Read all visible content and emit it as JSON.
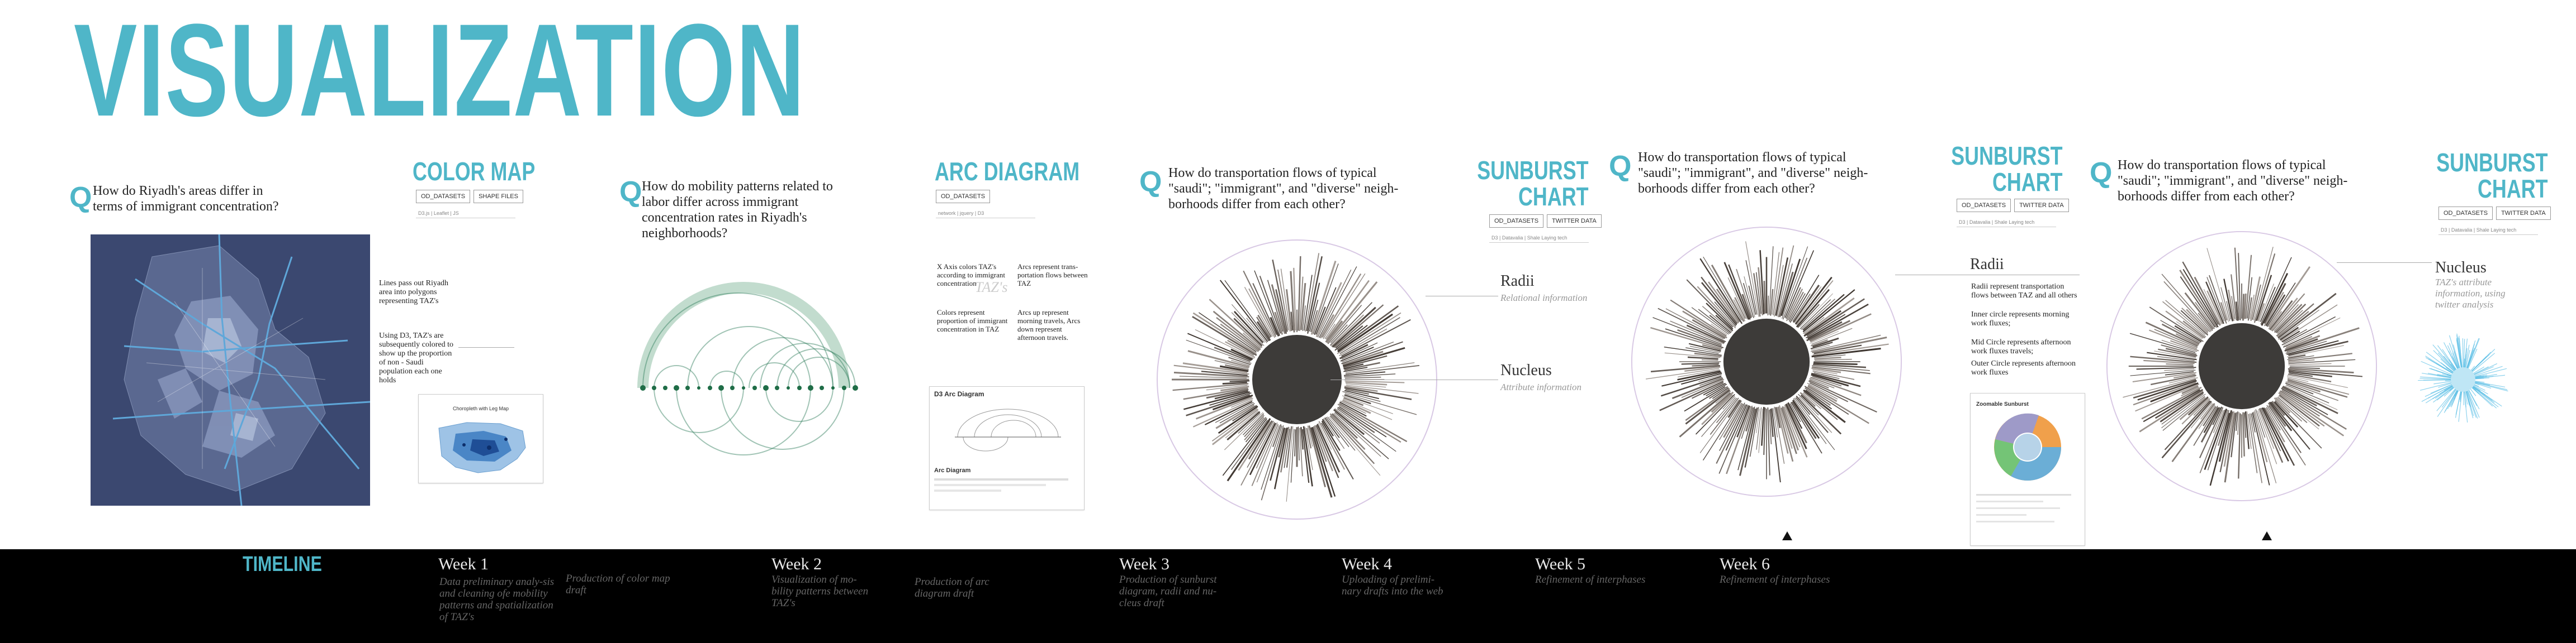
{
  "title": "VISUALIZATION",
  "panel1": {
    "q": "Q",
    "question": "How do Riyadh's areas differ in terms of immigrant concentration?",
    "title": "COLOR MAP",
    "chips": [
      "OD_DATASETS",
      "SHAPE FILES"
    ],
    "meta": "D3.js  |  Leaflet  |  JS",
    "note1": "Lines pass out Riyadh area into polygons representing TAZ's",
    "note2": "Using D3, TAZ's are subsequently colored to show up the proportion of non - Saudi population each one holds",
    "thumb_title": "Choropleth with Leg Map"
  },
  "panel2": {
    "q": "Q",
    "question": "How do mobility patterns related to labor differ across immigrant concentration rates in Riyadh's neighborhoods?",
    "title": "ARC DIAGRAM",
    "chips": [
      "OD_DATASETS"
    ],
    "meta": "network  |  jquery  |  D3",
    "note_x": "X Axis colors TAZ's according to immigrant concentration",
    "note_colors": "Colors represent proportion of immigrant concentration in TAZ",
    "note_arcs_rep": "Arcs represent trans-portation flows between TAZ",
    "note_arcs_up": "Arcs up represent morning travels, Arcs down represent afternoon travels.",
    "ghost": "TAZ's",
    "thumb_title": "D3 Arc Diagram",
    "thumb_sub": "Arc Diagram"
  },
  "panel3": {
    "q": "Q",
    "question": "How do transportation flows of typical \"saudi\"; \"immigrant\", and \"diverse\" neigh-borhoods differ from each other?",
    "title1": "SUNBURST",
    "title2": "CHART",
    "chips": [
      "OD_DATASETS",
      "TWITTER DATA"
    ],
    "meta": "D3  |  Datavalia  |  Shale  Laying tech",
    "radii": "Radii",
    "radii_sub": "Relational information",
    "nucleus": "Nucleus",
    "nucleus_sub": "Attribute information"
  },
  "panel4": {
    "q": "Q",
    "question": "How do transportation flows of typical \"saudi\"; \"immigrant\", and \"diverse\" neigh-borhoods differ from each other?",
    "title1": "SUNBURST",
    "title2": "CHART",
    "chips": [
      "OD_DATASETS",
      "TWITTER DATA"
    ],
    "meta": "D3  |  Datavalia  |  Shale  Laying tech",
    "radii": "Radii",
    "note_radii": "Radii represent transportation flows between TAZ and all others",
    "note_inner": "Inner circle represents morning work fluxes;",
    "note_mid": "Mid Circle represents afternoon work fluxes travels;",
    "note_outer": "Outer Circle represents afternoon work fluxes",
    "thumb_title": "Zoomable Sunburst"
  },
  "panel5": {
    "q": "Q",
    "question": "How do transportation flows of typical \"saudi\"; \"immigrant\", and \"diverse\" neigh-borhoods differ from each other?",
    "title1": "SUNBURST",
    "title2": "CHART",
    "chips": [
      "OD_DATASETS",
      "TWITTER DATA"
    ],
    "meta": "D3  |  Datavalia  |  Shale  Laying tech",
    "nucleus": "Nucleus",
    "nucleus_sub": "TAZ's attribute information, using twitter analysis"
  },
  "timeline": {
    "title": "TIMELINE",
    "weeks": [
      {
        "label": "Week 1",
        "desc": "Data preliminary analy-sis and cleaning ofe mobility patterns and spatialization of TAZ's"
      },
      {
        "label": "Production of color map draft"
      },
      {
        "label": "Week 2",
        "desc": "Visualization of mo-bility patterns between TAZ's"
      },
      {
        "label": "Production of arc diagram draft"
      },
      {
        "label": "Week 3",
        "desc": "Production of sunburst diagram, radii and nu-cleus draft"
      },
      {
        "label": "Week 4",
        "desc": "Uploading of prelimi-nary drafts into the web"
      },
      {
        "label": "Week 5",
        "desc": "Refinement of interphases"
      },
      {
        "label": "Week 6",
        "desc": "Refinement of interphases"
      }
    ]
  },
  "colors": {
    "accent": "#4fb6c8",
    "map_bg": "#3b4870",
    "arc": "#2e7c5a",
    "timeline_bg": "#000000"
  }
}
